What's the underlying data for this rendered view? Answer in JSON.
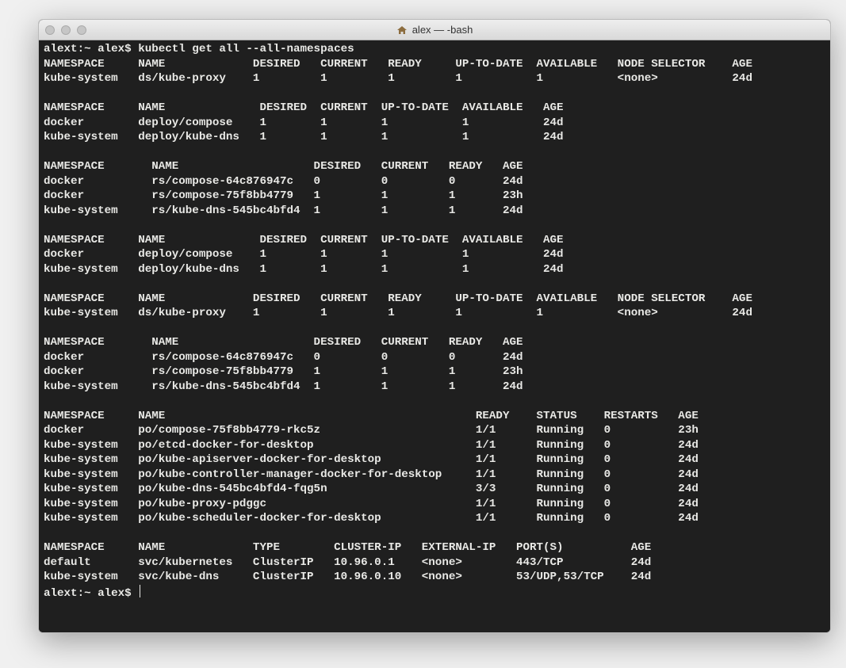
{
  "window": {
    "title": "alex — -bash"
  },
  "prompt": {
    "line1": "alext:~ alex$ kubectl get all --all-namespaces",
    "line_end": "alext:~ alex$ "
  },
  "block1": {
    "header": [
      "NAMESPACE",
      "NAME",
      "DESIRED",
      "CURRENT",
      "READY",
      "UP-TO-DATE",
      "AVAILABLE",
      "NODE SELECTOR",
      "AGE"
    ],
    "rows": [
      [
        "kube-system",
        "ds/kube-proxy",
        "1",
        "1",
        "1",
        "1",
        "1",
        "<none>",
        "24d"
      ]
    ]
  },
  "block2": {
    "header": [
      "NAMESPACE",
      "NAME",
      "DESIRED",
      "CURRENT",
      "UP-TO-DATE",
      "AVAILABLE",
      "AGE"
    ],
    "rows": [
      [
        "docker",
        "deploy/compose",
        "1",
        "1",
        "1",
        "1",
        "24d"
      ],
      [
        "kube-system",
        "deploy/kube-dns",
        "1",
        "1",
        "1",
        "1",
        "24d"
      ]
    ]
  },
  "block3": {
    "header": [
      "NAMESPACE",
      "NAME",
      "DESIRED",
      "CURRENT",
      "READY",
      "AGE"
    ],
    "rows": [
      [
        "docker",
        "rs/compose-64c876947c",
        "0",
        "0",
        "0",
        "24d"
      ],
      [
        "docker",
        "rs/compose-75f8bb4779",
        "1",
        "1",
        "1",
        "23h"
      ],
      [
        "kube-system",
        "rs/kube-dns-545bc4bfd4",
        "1",
        "1",
        "1",
        "24d"
      ]
    ]
  },
  "block4": {
    "header": [
      "NAMESPACE",
      "NAME",
      "DESIRED",
      "CURRENT",
      "UP-TO-DATE",
      "AVAILABLE",
      "AGE"
    ],
    "rows": [
      [
        "docker",
        "deploy/compose",
        "1",
        "1",
        "1",
        "1",
        "24d"
      ],
      [
        "kube-system",
        "deploy/kube-dns",
        "1",
        "1",
        "1",
        "1",
        "24d"
      ]
    ]
  },
  "block5": {
    "header": [
      "NAMESPACE",
      "NAME",
      "DESIRED",
      "CURRENT",
      "READY",
      "UP-TO-DATE",
      "AVAILABLE",
      "NODE SELECTOR",
      "AGE"
    ],
    "rows": [
      [
        "kube-system",
        "ds/kube-proxy",
        "1",
        "1",
        "1",
        "1",
        "1",
        "<none>",
        "24d"
      ]
    ]
  },
  "block6": {
    "header": [
      "NAMESPACE",
      "NAME",
      "DESIRED",
      "CURRENT",
      "READY",
      "AGE"
    ],
    "rows": [
      [
        "docker",
        "rs/compose-64c876947c",
        "0",
        "0",
        "0",
        "24d"
      ],
      [
        "docker",
        "rs/compose-75f8bb4779",
        "1",
        "1",
        "1",
        "23h"
      ],
      [
        "kube-system",
        "rs/kube-dns-545bc4bfd4",
        "1",
        "1",
        "1",
        "24d"
      ]
    ]
  },
  "block7": {
    "header": [
      "NAMESPACE",
      "NAME",
      "READY",
      "STATUS",
      "RESTARTS",
      "AGE"
    ],
    "rows": [
      [
        "docker",
        "po/compose-75f8bb4779-rkc5z",
        "1/1",
        "Running",
        "0",
        "23h"
      ],
      [
        "kube-system",
        "po/etcd-docker-for-desktop",
        "1/1",
        "Running",
        "0",
        "24d"
      ],
      [
        "kube-system",
        "po/kube-apiserver-docker-for-desktop",
        "1/1",
        "Running",
        "0",
        "24d"
      ],
      [
        "kube-system",
        "po/kube-controller-manager-docker-for-desktop",
        "1/1",
        "Running",
        "0",
        "24d"
      ],
      [
        "kube-system",
        "po/kube-dns-545bc4bfd4-fqg5n",
        "3/3",
        "Running",
        "0",
        "24d"
      ],
      [
        "kube-system",
        "po/kube-proxy-pdggc",
        "1/1",
        "Running",
        "0",
        "24d"
      ],
      [
        "kube-system",
        "po/kube-scheduler-docker-for-desktop",
        "1/1",
        "Running",
        "0",
        "24d"
      ]
    ]
  },
  "block8": {
    "header": [
      "NAMESPACE",
      "NAME",
      "TYPE",
      "CLUSTER-IP",
      "EXTERNAL-IP",
      "PORT(S)",
      "AGE"
    ],
    "rows": [
      [
        "default",
        "svc/kubernetes",
        "ClusterIP",
        "10.96.0.1",
        "<none>",
        "443/TCP",
        "24d"
      ],
      [
        "kube-system",
        "svc/kube-dns",
        "ClusterIP",
        "10.96.0.10",
        "<none>",
        "53/UDP,53/TCP",
        "24d"
      ]
    ]
  },
  "cols": {
    "b1": [
      14,
      17,
      10,
      10,
      10,
      12,
      12,
      17,
      4
    ],
    "b2": [
      14,
      18,
      9,
      9,
      12,
      12,
      5
    ],
    "b3": [
      16,
      24,
      10,
      10,
      8,
      5
    ],
    "b4": [
      14,
      18,
      9,
      9,
      12,
      12,
      5
    ],
    "b5": [
      14,
      17,
      10,
      10,
      10,
      12,
      12,
      17,
      4
    ],
    "b6": [
      16,
      24,
      10,
      10,
      8,
      5
    ],
    "b7": [
      14,
      50,
      9,
      10,
      11,
      4
    ],
    "b8": [
      14,
      17,
      12,
      13,
      14,
      17,
      4
    ]
  }
}
